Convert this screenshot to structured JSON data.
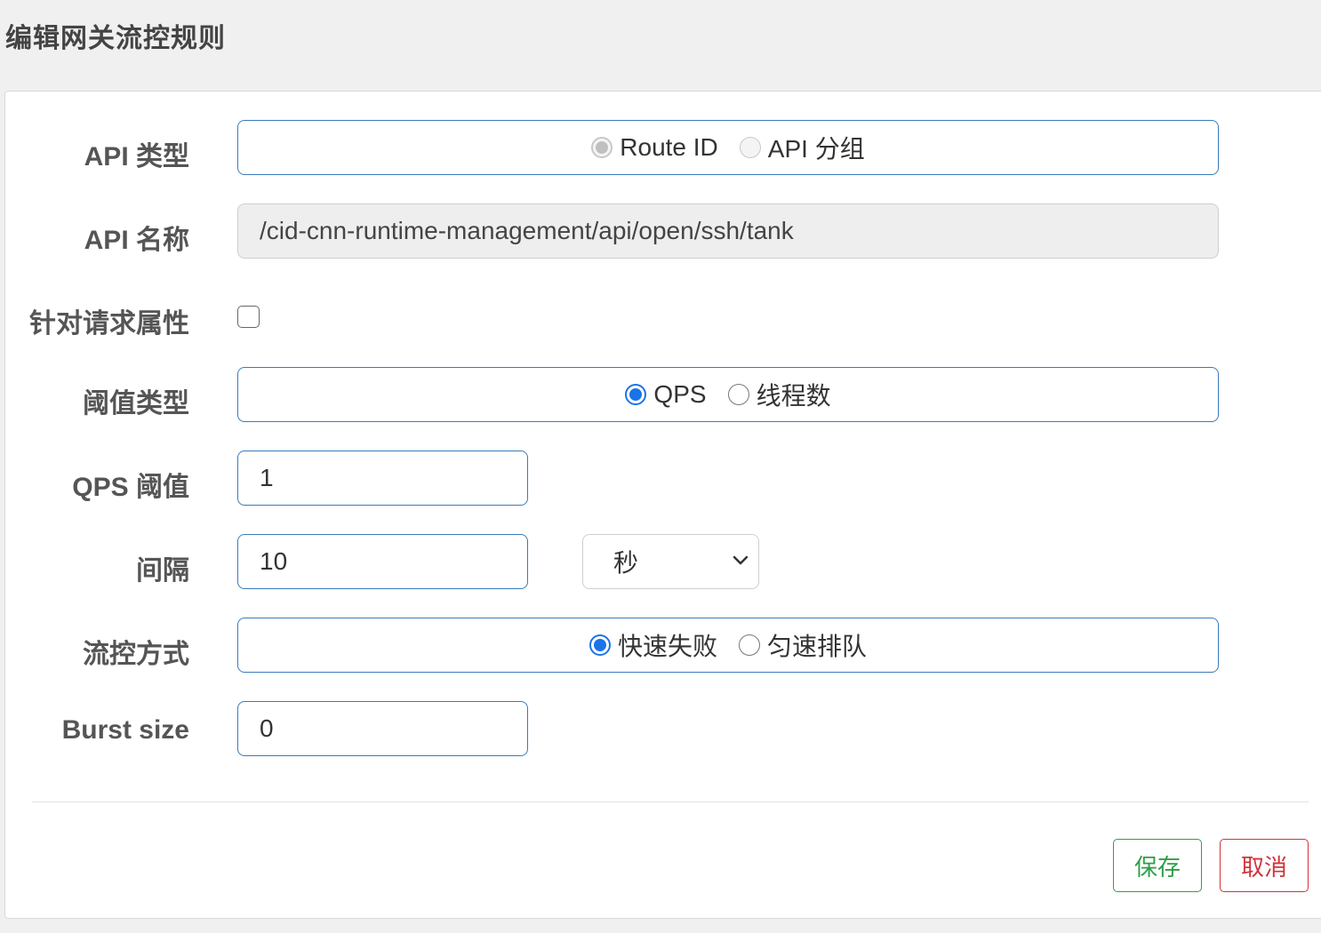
{
  "page": {
    "title": "编辑网关流控规则"
  },
  "form": {
    "api_type": {
      "label": "API 类型",
      "options": [
        "Route ID",
        "API 分组"
      ],
      "selected": "Route ID",
      "disabled": true
    },
    "api_name": {
      "label": "API 名称",
      "value": "/cid-cnn-runtime-management/api/open/ssh/tank",
      "readonly": true
    },
    "request_attr": {
      "label": "针对请求属性",
      "checked": false
    },
    "threshold_type": {
      "label": "阈值类型",
      "options": [
        "QPS",
        "线程数"
      ],
      "selected": "QPS"
    },
    "qps_threshold": {
      "label": "QPS 阈值",
      "value": "1"
    },
    "interval": {
      "label": "间隔",
      "value": "10",
      "unit": "秒"
    },
    "control_mode": {
      "label": "流控方式",
      "options": [
        "快速失败",
        "匀速排队"
      ],
      "selected": "快速失败"
    },
    "burst_size": {
      "label": "Burst size",
      "value": "0"
    }
  },
  "footer": {
    "save_label": "保存",
    "cancel_label": "取消"
  },
  "colors": {
    "accent": "#1a73e8",
    "input_border": "#3a7bb8",
    "save": "#2e9e4a",
    "cancel": "#d0343b"
  }
}
